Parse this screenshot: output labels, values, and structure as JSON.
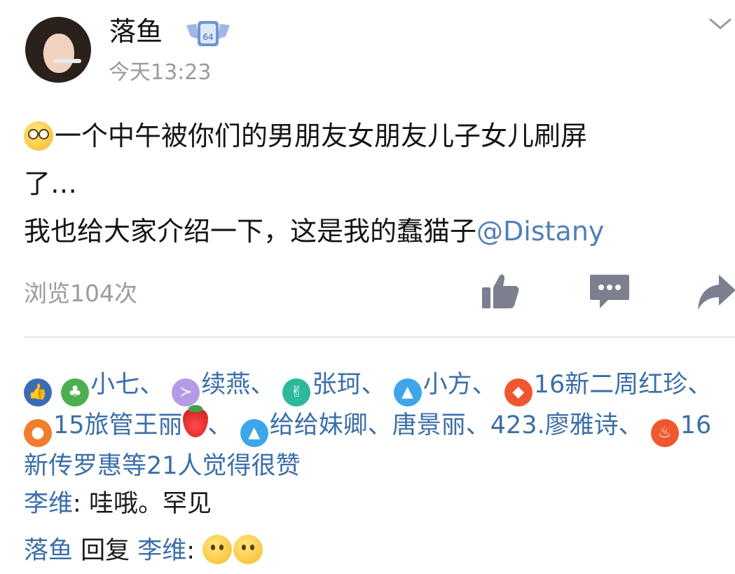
{
  "user": {
    "name": "落鱼",
    "time": "今天13:23",
    "badge_text": "64"
  },
  "post": {
    "text_line1": "一个中午被你们的男朋友女朋友儿子女儿刷屏",
    "text_line2": "了…",
    "text_line3": "我也给大家介绍一下，这是我的蠢猫子",
    "mention": "@Distany"
  },
  "stats": {
    "views": "浏览104次"
  },
  "actions": {
    "like_icon": "thumbs-up-icon",
    "comment_icon": "comment-icon",
    "share_icon": "share-icon"
  },
  "likes": {
    "names": [
      "小七、",
      "续燕、",
      "张珂、",
      "小方、",
      "16新二周红珍、",
      "15旅管王丽",
      "、",
      "给给妹卿、唐景丽、423.廖雅诗、",
      "16新传罗惠等21人觉得很赞"
    ]
  },
  "comments": [
    {
      "author": "李维",
      "sep": ":",
      "text": " 哇哦。罕见"
    },
    {
      "author": "落鱼",
      "reply_word": " 回复 ",
      "target": "李维",
      "sep": ":"
    }
  ],
  "colors": {
    "link": "#3b6ea8",
    "mention": "#527fb8",
    "muted": "#9b9b9b",
    "icon": "#7b7f8e"
  }
}
